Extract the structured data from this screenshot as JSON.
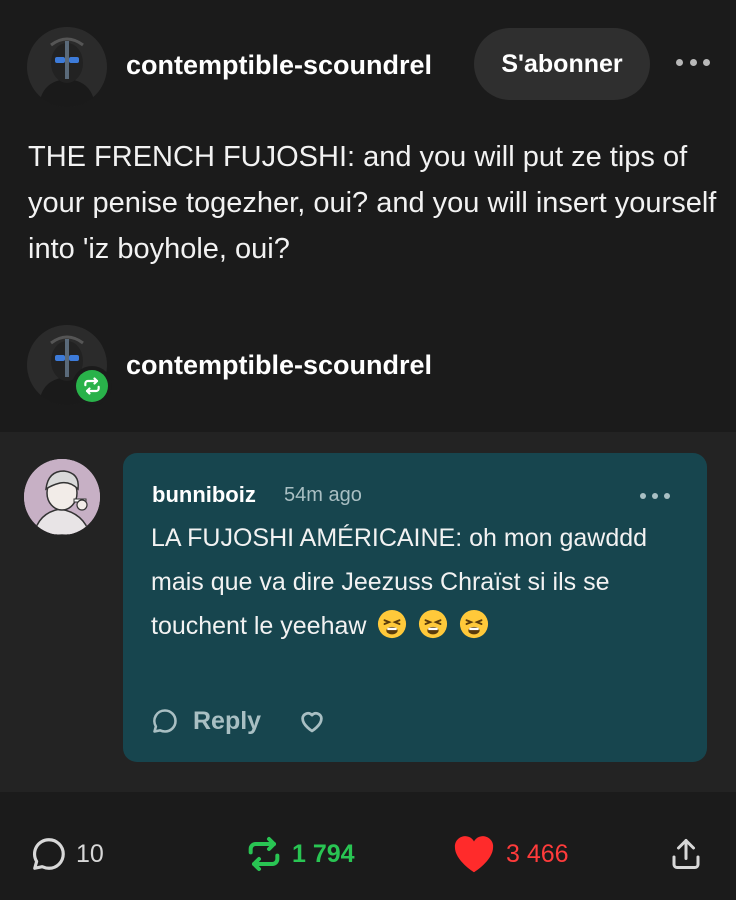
{
  "post": {
    "username": "contemptible-scoundrel",
    "follow_label": "S'abonner",
    "text": "THE FRENCH FUJOSHI: and you will put ze tips of your penise togezher, oui? and you will insert yourself into 'iz boyhole, oui?"
  },
  "reblog": {
    "username": "contemptible-scoundrel"
  },
  "reply": {
    "username": "bunniboiz",
    "time": "54m ago",
    "text": "LA FUJOSHI AMÉRICAINE: oh mon gawddd mais que va dire Jeezuss Chraïst si ils se touchent le yeehaw",
    "emoji": "tired-face",
    "reply_label": "Reply"
  },
  "footer": {
    "notes_count": "10",
    "reblogs_count": "1 794",
    "likes_count": "3 466"
  },
  "colors": {
    "background": "#1b1b1b",
    "reply_bubble": "#17454e",
    "reblog_green": "#29c553",
    "like_red": "#ff3b3b"
  }
}
